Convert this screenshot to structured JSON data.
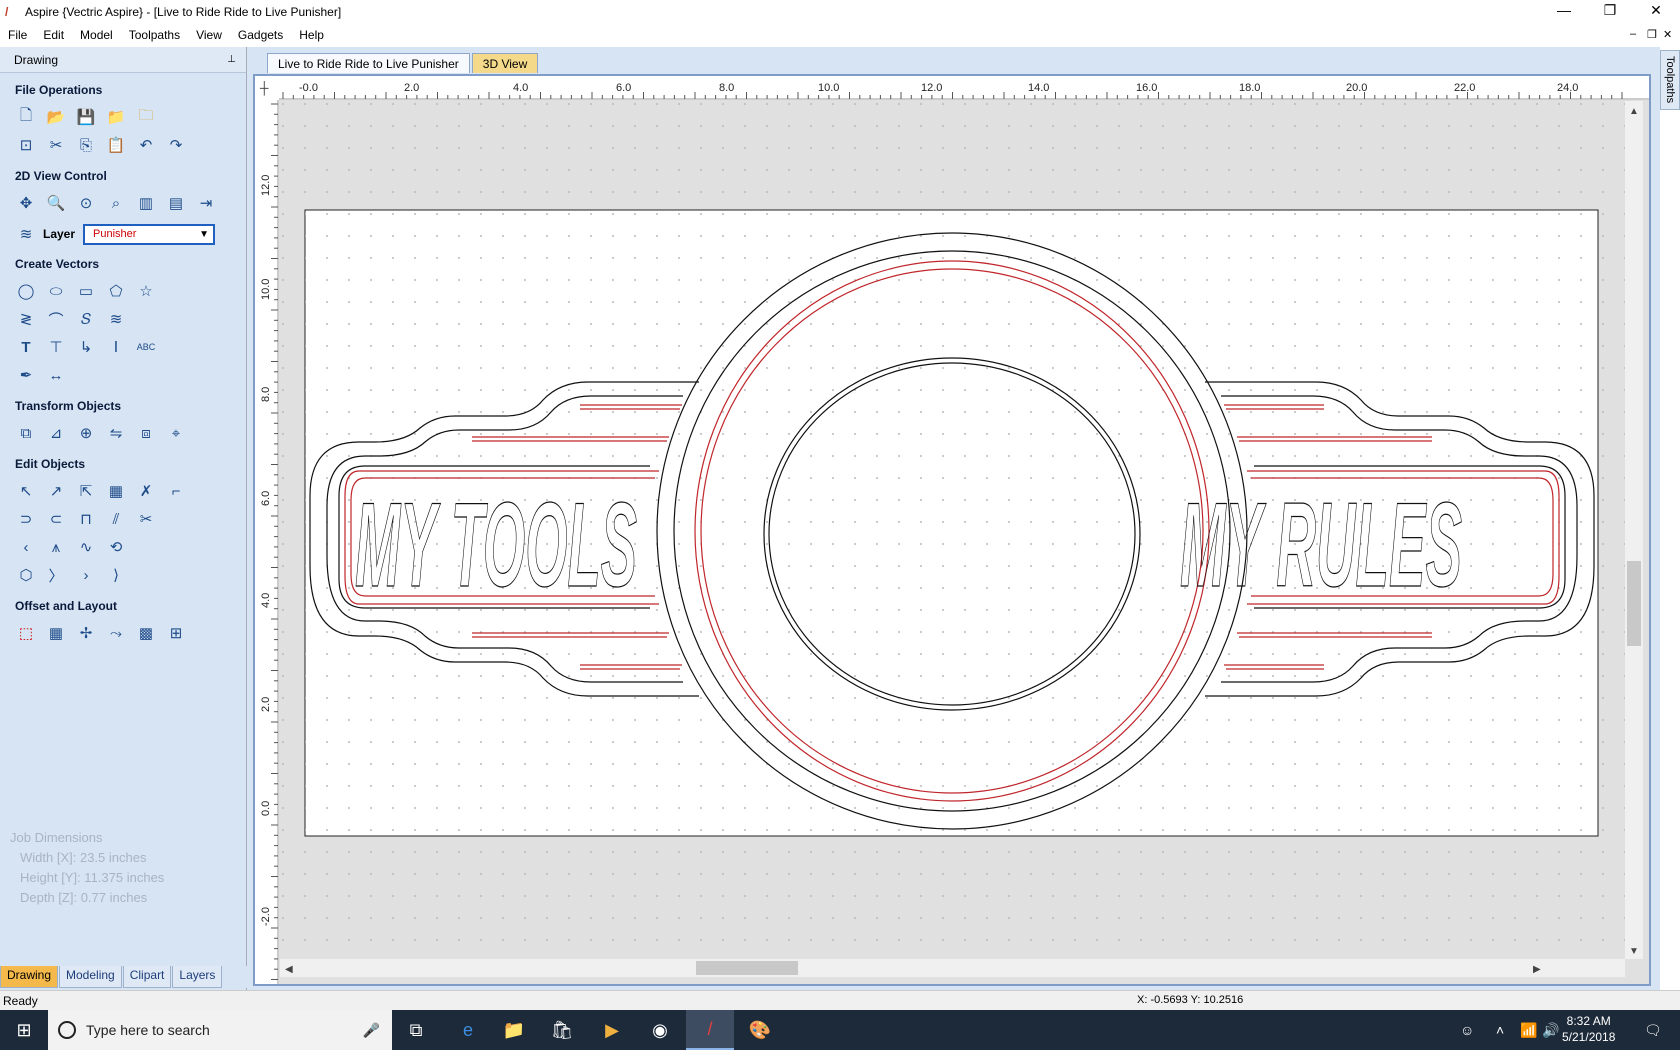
{
  "window": {
    "title": "Aspire {Vectric Aspire} - [Live to Ride Ride to Live Punisher]",
    "minimize": "—",
    "restore": "❐",
    "close": "✕"
  },
  "menu": {
    "items": [
      "File",
      "Edit",
      "Model",
      "Toolpaths",
      "View",
      "Gadgets",
      "Help"
    ]
  },
  "panel": {
    "title": "Drawing",
    "pin": "📌",
    "sections": {
      "file_ops": "File Operations",
      "view_control": "2D View Control",
      "create_vectors": "Create Vectors",
      "transform": "Transform Objects",
      "edit_objects": "Edit Objects",
      "offset_layout": "Offset and Layout"
    },
    "layer": {
      "label": "Layer",
      "value": "Punisher"
    },
    "job": {
      "title": "Job Dimensions",
      "width": "Width  [X]: 23.5 inches",
      "height": "Height [Y]: 11.375 inches",
      "depth": "Depth  [Z]: 0.77 inches"
    },
    "tabs": [
      "Drawing",
      "Modeling",
      "Clipart",
      "Layers"
    ]
  },
  "document": {
    "tabs": [
      "Live to Ride Ride to Live Punisher",
      "3D View"
    ],
    "ruler_x": [
      "-0.0",
      "2.0",
      "4.0",
      "6.0",
      "8.0",
      "10.0",
      "12.0",
      "14.0",
      "16.0",
      "18.0",
      "20.0",
      "22.0",
      "24.0"
    ],
    "ruler_y": [
      "12.0",
      "10.0",
      "8.0",
      "6.0",
      "4.0",
      "2.0",
      "0.0",
      "-2.0"
    ],
    "text_left": "MY TOOLS",
    "text_right": "MY RULES",
    "side_tab": "Toolpaths"
  },
  "status": {
    "ready": "Ready",
    "coords": "X: -0.5693 Y: 10.2516"
  },
  "taskbar": {
    "search_placeholder": "Type here to search",
    "time": "8:32 AM",
    "date": "5/21/2018"
  }
}
